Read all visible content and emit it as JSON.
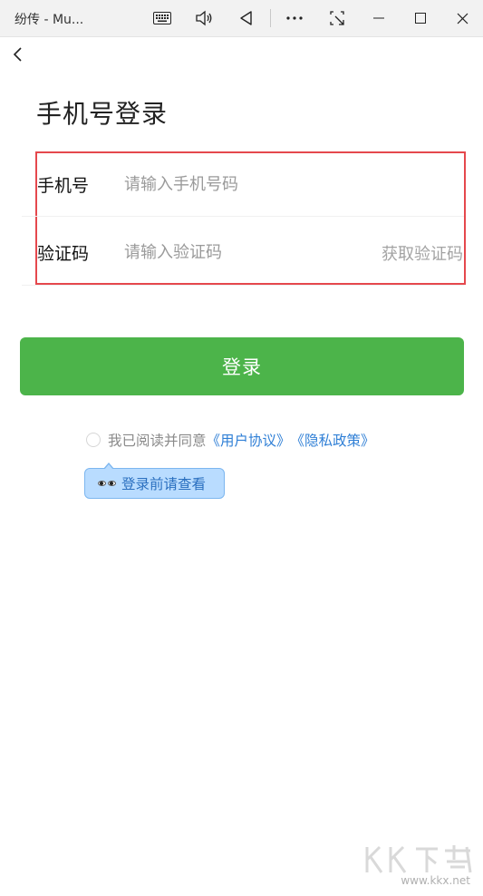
{
  "window": {
    "title": "纷传 - Mu...",
    "icons": [
      "keyboard-icon",
      "volume-icon",
      "back-triangle-icon",
      "more-icon",
      "screenshot-icon",
      "minimize-icon",
      "maximize-icon",
      "close-icon"
    ]
  },
  "page": {
    "title": "手机号登录"
  },
  "form": {
    "phone_label": "手机号",
    "phone_placeholder": "请输入手机号码",
    "code_label": "验证码",
    "code_placeholder": "请输入验证码",
    "get_code": "获取验证码"
  },
  "login_button": "登录",
  "agreement": {
    "prefix": "我已阅读并同意",
    "user_agreement": "《用户协议》",
    "privacy_policy": "《隐私政策》"
  },
  "tooltip": "登录前请查看",
  "watermark": {
    "text": "www.kkx.net"
  },
  "colors": {
    "primary": "#4cb44a",
    "link": "#2f7fd6",
    "highlight_border": "#e5484d",
    "tooltip_bg": "#b9dcff"
  }
}
